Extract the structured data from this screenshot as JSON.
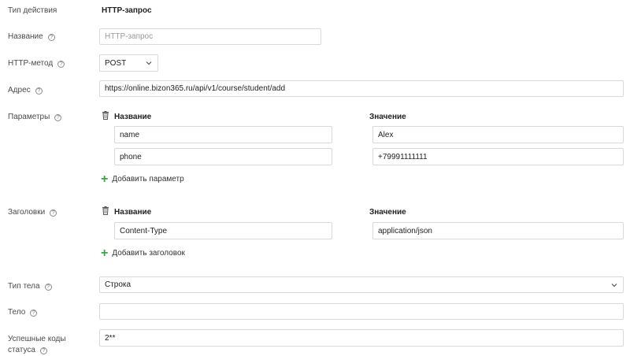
{
  "action_type": {
    "label": "Тип действия",
    "value": "HTTP-запрос"
  },
  "name_field": {
    "label": "Название",
    "placeholder": "HTTP-запрос"
  },
  "method": {
    "label": "HTTP-метод",
    "value": "POST"
  },
  "address": {
    "label": "Адрес",
    "value": "https://online.bizon365.ru/api/v1/course/student/add"
  },
  "params": {
    "label": "Параметры",
    "col_name": "Название",
    "col_value": "Значение",
    "rows": [
      {
        "name": "name",
        "value": "Alex"
      },
      {
        "name": "phone",
        "value": "+79991111111"
      }
    ],
    "add_label": "Добавить параметр"
  },
  "headers": {
    "label": "Заголовки",
    "col_name": "Название",
    "col_value": "Значение",
    "rows": [
      {
        "name": "Content-Type",
        "value": "application/json"
      }
    ],
    "add_label": "Добавить заголовок"
  },
  "body_type": {
    "label": "Тип тела",
    "value": "Строка"
  },
  "body": {
    "label": "Тело",
    "value": ""
  },
  "status_codes": {
    "label_line1": "Успешные коды",
    "label_line2": "статуса",
    "value": "2**"
  },
  "icons": {
    "help": "help-icon",
    "trash": "trash-icon",
    "plus": "plus-icon",
    "chevron": "chevron-down-icon"
  },
  "colors": {
    "accent_green": "#3aa54a",
    "border": "#d9d9d9"
  }
}
